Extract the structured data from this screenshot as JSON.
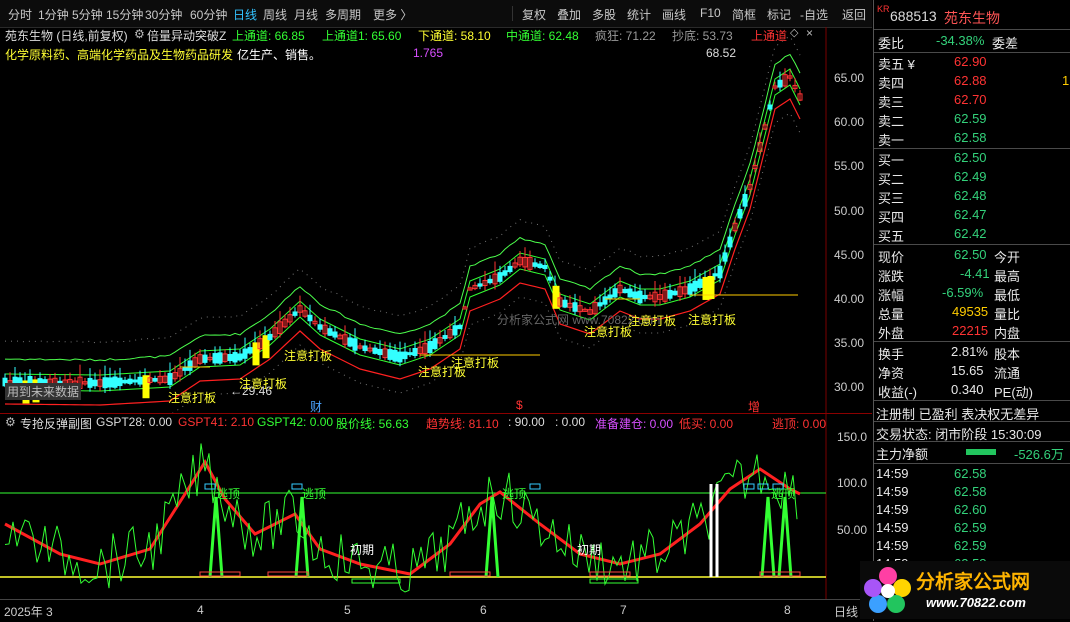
{
  "toolbar": {
    "left_items": [
      "分时",
      "1分钟",
      "5分钟",
      "15分钟",
      "30分钟",
      "60分钟",
      "日线",
      "周线",
      "月线",
      "多周期",
      "更多 〉"
    ],
    "active_index": 6,
    "right_items": [
      "复权",
      "叠加",
      "多股",
      "统计",
      "画线",
      "F10",
      "简框",
      "标记",
      "-自选",
      "返回"
    ]
  },
  "main_legend": {
    "title": "苑东生物 (日线,前复权)",
    "indicator": "倍量异动突破Z",
    "up_channel": "上通道: 66.85",
    "up_channel1": "上通道1: 65.60",
    "down_channel": "下通道: 58.10",
    "mid_channel": "中通道: 62.48",
    "crazy": "疯狂: 71.22",
    "bottom": "抄底: 53.73",
    "up_channel2": "上通道",
    "business": "化学原料药、高端化学药品及生物药品研发",
    "business_extra": "亿生产、销售。",
    "value_1765": "1.765",
    "peak_label": "68.52",
    "low_label": "←29.46",
    "future_label": "用到未来数据",
    "watermark": "分析家公式网 www.70822.com",
    "markers": [
      "财",
      "$",
      "增"
    ]
  },
  "price_axis": [
    "65.00",
    "60.00",
    "55.00",
    "50.00",
    "45.00",
    "40.00",
    "35.00",
    "30.00"
  ],
  "board_labels": [
    "注意打板",
    "注意打板",
    "注意打板",
    "注意打板",
    "注意打板",
    "注意打板",
    "注意打板",
    "注意打板"
  ],
  "sub_legend": {
    "name": "专抢反弹副图",
    "gspt28": "GSPT28: 0.00",
    "gspt41": "GSPT41: 2.10",
    "gspt42": "GSPT42: 0.00",
    "price_line": "股价线: 56.63",
    "trend_line": "趋势线: 81.10",
    "val90": ": 90.00",
    "val0": ": 0.00",
    "prepare": "准备建仓: 0.00",
    "low_buy": "低买: 0.00",
    "escape": "逃顶: 0.00"
  },
  "sub_axis": [
    "150.0",
    "100.0",
    "50.00"
  ],
  "sub_labels": {
    "escape": "逃顶",
    "initial": "初期"
  },
  "time_axis": {
    "labels": [
      "2025年 3",
      "4",
      "5",
      "6",
      "7",
      "8"
    ],
    "period": "日线"
  },
  "quote": {
    "market_tag": "KR",
    "code": "688513",
    "name": "苑东生物",
    "webi_label": "委比",
    "webi_value": "-34.38%",
    "wecha_label": "委差",
    "asks": [
      {
        "label": "卖五 ¥",
        "price": "62.90"
      },
      {
        "label": "卖四",
        "price": "62.88"
      },
      {
        "label": "卖三",
        "price": "62.70"
      },
      {
        "label": "卖二",
        "price": "62.59"
      },
      {
        "label": "卖一",
        "price": "62.58"
      }
    ],
    "ask_volume_side": "1",
    "bids": [
      {
        "label": "买一",
        "price": "62.50"
      },
      {
        "label": "买二",
        "price": "62.49"
      },
      {
        "label": "买三",
        "price": "62.48"
      },
      {
        "label": "买四",
        "price": "62.47"
      },
      {
        "label": "买五",
        "price": "62.42"
      }
    ],
    "stats": [
      {
        "l1": "现价",
        "v1": "62.50",
        "l2": "今开"
      },
      {
        "l1": "涨跌",
        "v1": "-4.41",
        "l2": "最高"
      },
      {
        "l1": "涨幅",
        "v1": "-6.59%",
        "l2": "最低"
      },
      {
        "l1": "总量",
        "v1": "49535",
        "l2": "量比"
      },
      {
        "l1": "外盘",
        "v1": "22215",
        "l2": "内盘"
      }
    ],
    "stats2": [
      {
        "l1": "换手",
        "v1": "2.81%",
        "l2": "股本"
      },
      {
        "l1": "净资",
        "v1": "15.65",
        "l2": "流通"
      },
      {
        "l1": "收益(-)",
        "v1": "0.340",
        "l2": "PE(动)"
      }
    ],
    "registration": "注册制 已盈利 表决权无差异",
    "trade_status": "交易状态: 闭市阶段 15:30:09",
    "main_flow_label": "主力净额",
    "main_flow_value": "-526.6万",
    "ticks": [
      {
        "time": "14:59",
        "price": "62.58"
      },
      {
        "time": "14:59",
        "price": "62.58"
      },
      {
        "time": "14:59",
        "price": "62.60"
      },
      {
        "time": "14:59",
        "price": "62.59"
      },
      {
        "time": "14:59",
        "price": "62.59"
      },
      {
        "time": "14:59",
        "price": "62.58"
      }
    ]
  },
  "logo": {
    "text": "分析家公式网",
    "url": "www.70822.com"
  },
  "colors": {
    "up": "#ff3333",
    "down": "#33ffff",
    "yellow": "#ffff00",
    "green": "#00ff00",
    "channel_red": "#ff2020"
  }
}
